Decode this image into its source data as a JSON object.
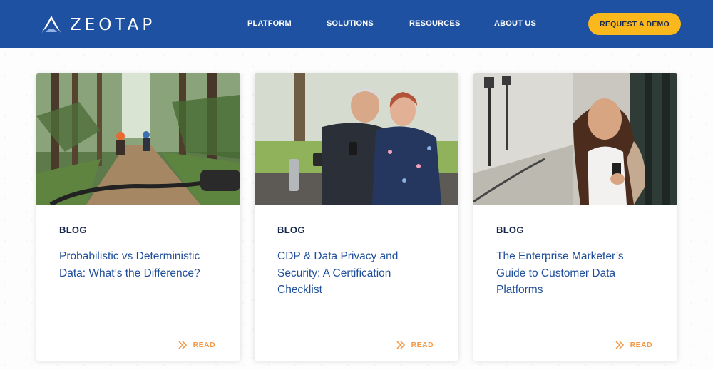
{
  "brand": {
    "name": "ZEOTAP"
  },
  "nav": {
    "items": [
      "PLATFORM",
      "SOLUTIONS",
      "RESOURCES",
      "ABOUT US"
    ],
    "cta": "REQUEST A DEMO"
  },
  "colors": {
    "header_bg": "#1f51a3",
    "cta_bg": "#fbb81c",
    "title_blue": "#1f4e9a",
    "read_orange": "#f29a4a"
  },
  "cards": [
    {
      "category": "BLOG",
      "title": "Probabilistic vs Deterministic Data: What’s the Difference?",
      "read_label": "READ",
      "image": "cyclists-on-forest-trail"
    },
    {
      "category": "BLOG",
      "title": "CDP & Data Privacy and Security: A Certification Checklist",
      "read_label": "READ",
      "image": "senior-couple-with-phone"
    },
    {
      "category": "BLOG",
      "title": "The Enterprise Marketer’s Guide to Customer Data Platforms",
      "read_label": "READ",
      "image": "woman-smiling-at-phone"
    }
  ]
}
